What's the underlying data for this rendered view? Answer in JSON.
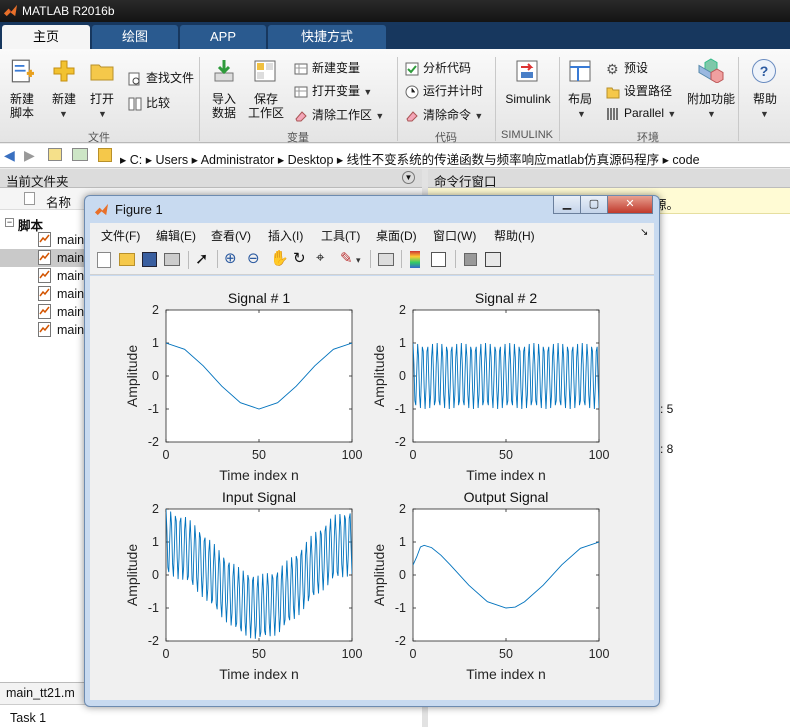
{
  "app": {
    "title": "MATLAB R2016b"
  },
  "tabs": [
    "主页",
    "绘图",
    "APP",
    "快捷方式"
  ],
  "ribbon": {
    "file": {
      "new_script": "新建\n脚本",
      "new": "新建",
      "open": "打开",
      "find_files": "查找文件",
      "compare": "比较",
      "section": "文件"
    },
    "variable": {
      "import": "导入\n数据",
      "save_ws": "保存\n工作区",
      "new_var": "新建变量",
      "open_var": "打开变量",
      "clear_ws": "清除工作区",
      "section": "变量"
    },
    "code": {
      "analyze": "分析代码",
      "run_time": "运行并计时",
      "clear_cmd": "清除命令",
      "section": "代码"
    },
    "simulink": {
      "label": "Simulink",
      "section": "SIMULINK"
    },
    "env": {
      "layout": "布局",
      "prefs": "预设",
      "set_path": "设置路径",
      "parallel": "Parallel",
      "section": "环境"
    },
    "addons": "附加功能",
    "help": "帮助"
  },
  "address": {
    "parts": [
      "C:",
      "Users",
      "Administrator",
      "Desktop",
      "线性不变系统的传递函数与频率响应matlab仿真源码程序",
      "code"
    ]
  },
  "current_folder": {
    "title": "当前文件夹",
    "name_header": "名称",
    "group": "脚本",
    "items": [
      "main",
      "main",
      "main",
      "main",
      "main",
      "main"
    ],
    "file_label": "main_tt21.m",
    "task": "Task 1"
  },
  "command_window": {
    "title": "命令行窗口",
    "notice": "不熟悉 MATLAB?请参阅有关快速入门的资源。",
    "notice_visible": "源。",
    "val1": "5",
    "val2": "8"
  },
  "figure": {
    "title": "Figure 1",
    "menu": [
      "文件(F)",
      "编辑(E)",
      "查看(V)",
      "插入(I)",
      "工具(T)",
      "桌面(D)",
      "窗口(W)",
      "帮助(H)"
    ]
  },
  "chart_data": [
    {
      "type": "line",
      "title": "Signal # 1",
      "xlabel": "Time index n",
      "ylabel": "Amplitude",
      "xlim": [
        0,
        100
      ],
      "ylim": [
        -2,
        2
      ],
      "xticks": [
        0,
        50,
        100
      ],
      "yticks": [
        -2,
        -1,
        0,
        1,
        2
      ],
      "x": [
        0,
        10,
        20,
        30,
        40,
        50,
        60,
        70,
        80,
        90,
        100
      ],
      "y": [
        1.0,
        0.81,
        0.31,
        -0.31,
        -0.81,
        -1.0,
        -0.81,
        -0.31,
        0.31,
        0.81,
        1.0
      ],
      "color": "#0072bd"
    },
    {
      "type": "line",
      "title": "Signal # 2",
      "xlabel": "Time index n",
      "ylabel": "Amplitude",
      "xlim": [
        0,
        100
      ],
      "ylim": [
        -2,
        2
      ],
      "xticks": [
        0,
        50,
        100
      ],
      "yticks": [
        -2,
        -1,
        0,
        1,
        2
      ],
      "x_range": [
        0,
        100
      ],
      "amplitude": 1,
      "period_samples": 2.6,
      "color": "#0072bd"
    },
    {
      "type": "line",
      "title": "Input Signal",
      "xlabel": "Time index n",
      "ylabel": "Amplitude",
      "xlim": [
        0,
        100
      ],
      "ylim": [
        -2,
        2
      ],
      "xticks": [
        0,
        50,
        100
      ],
      "yticks": [
        -2,
        -1,
        0,
        1,
        2
      ],
      "x_range": [
        0,
        100
      ],
      "description_components": [
        "Signal # 1",
        "Signal # 2"
      ],
      "color": "#0072bd"
    },
    {
      "type": "line",
      "title": "Output Signal",
      "xlabel": "Time index n",
      "ylabel": "Amplitude",
      "xlim": [
        0,
        100
      ],
      "ylim": [
        -2,
        2
      ],
      "xticks": [
        0,
        50,
        100
      ],
      "yticks": [
        -2,
        -1,
        0,
        1,
        2
      ],
      "x": [
        0,
        2,
        4,
        6,
        10,
        15,
        20,
        30,
        40,
        50,
        55,
        60,
        70,
        80,
        90,
        100
      ],
      "y": [
        0.3,
        0.55,
        0.85,
        0.9,
        0.83,
        0.6,
        0.31,
        -0.31,
        -0.81,
        -1.0,
        -0.97,
        -0.81,
        -0.31,
        0.31,
        0.81,
        1.0
      ],
      "color": "#0072bd"
    }
  ]
}
